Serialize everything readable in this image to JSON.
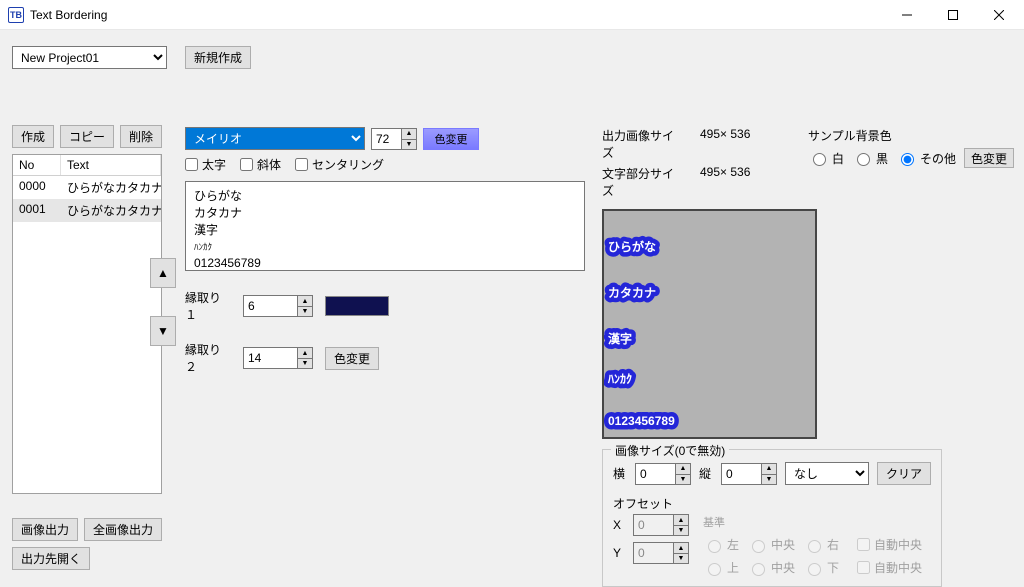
{
  "window": {
    "icon": "TB",
    "title": "Text Bordering"
  },
  "project": {
    "selected": "New Project01",
    "new_btn": "新規作成"
  },
  "left": {
    "create": "作成",
    "copy": "コピー",
    "delete": "削除",
    "col_no": "No",
    "col_text": "Text",
    "rows": [
      {
        "no": "0000",
        "text": "ひらがなカタカナ"
      },
      {
        "no": "0001",
        "text": "ひらがなカタカナ"
      }
    ],
    "export_one": "画像出力",
    "export_all": "全画像出力",
    "open_output": "出力先開く"
  },
  "mid": {
    "font": "メイリオ",
    "size": "72",
    "color_btn": "色変更",
    "bold": "太字",
    "italic": "斜体",
    "center": "センタリング",
    "lines": [
      "ひらがな",
      "カタカナ",
      "漢字",
      "ﾊﾝｶｸ",
      "0123456789"
    ],
    "b1_label": "縁取り１",
    "b1_value": "6",
    "b1_color": "#0f1150",
    "b2_label": "縁取り２",
    "b2_value": "14",
    "b2_btn": "色変更",
    "b2_color": "#ffffff"
  },
  "right": {
    "out_size_k": "出力画像サイズ",
    "out_size_v": "495× 536",
    "text_size_k": "文字部分サイズ",
    "text_size_v": "495× 536",
    "bg_title": "サンプル背景色",
    "bg_white": "白",
    "bg_black": "黒",
    "bg_other": "その他",
    "bg_btn": "色変更",
    "imgsize_legend": "画像サイズ(0で無効)",
    "w_l": "横",
    "w_v": "0",
    "h_l": "縦",
    "h_v": "0",
    "scale_sel": "なし",
    "clear": "クリア",
    "offset_title": "オフセット",
    "x_l": "X",
    "x_v": "0",
    "y_l": "Y",
    "y_v": "0",
    "basis_title": "基準",
    "bx1": "左",
    "bx2": "中央",
    "bx3": "右",
    "bx_auto": "自動中央",
    "by1": "上",
    "by2": "中央",
    "by3": "下",
    "by_auto": "自動中央"
  }
}
